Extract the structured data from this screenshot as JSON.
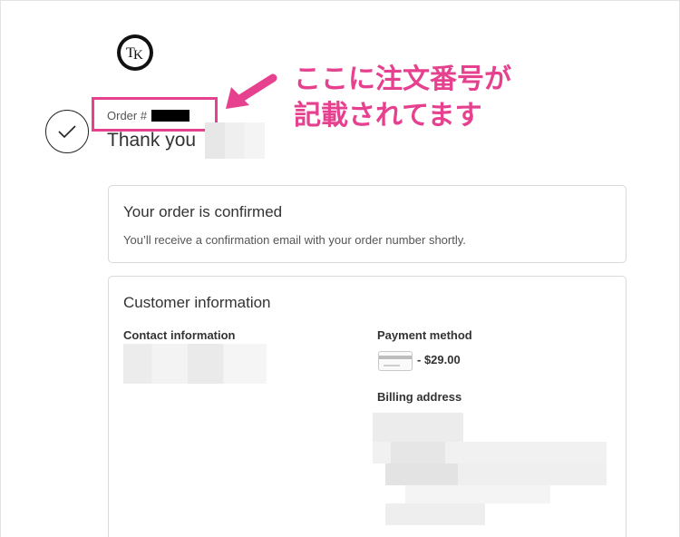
{
  "header": {
    "logo_alt": "TK",
    "order_label": "Order #",
    "thanks_text": "Thank you"
  },
  "annotation": {
    "callout_line1": "ここに注文番号が",
    "callout_line2": "記載されてます",
    "color": "#e6418f"
  },
  "confirmation_card": {
    "title": "Your order is confirmed",
    "text": "You’ll receive a confirmation email with your order number shortly."
  },
  "customer_card": {
    "title": "Customer information",
    "contact_label": "Contact information",
    "payment_label": "Payment method",
    "payment_amount": "- $29.00",
    "billing_label": "Billing address"
  },
  "icons": {
    "logo": "tk-logo-icon",
    "check": "check-icon",
    "arrow": "pink-arrow-icon",
    "card": "credit-card-icon"
  }
}
